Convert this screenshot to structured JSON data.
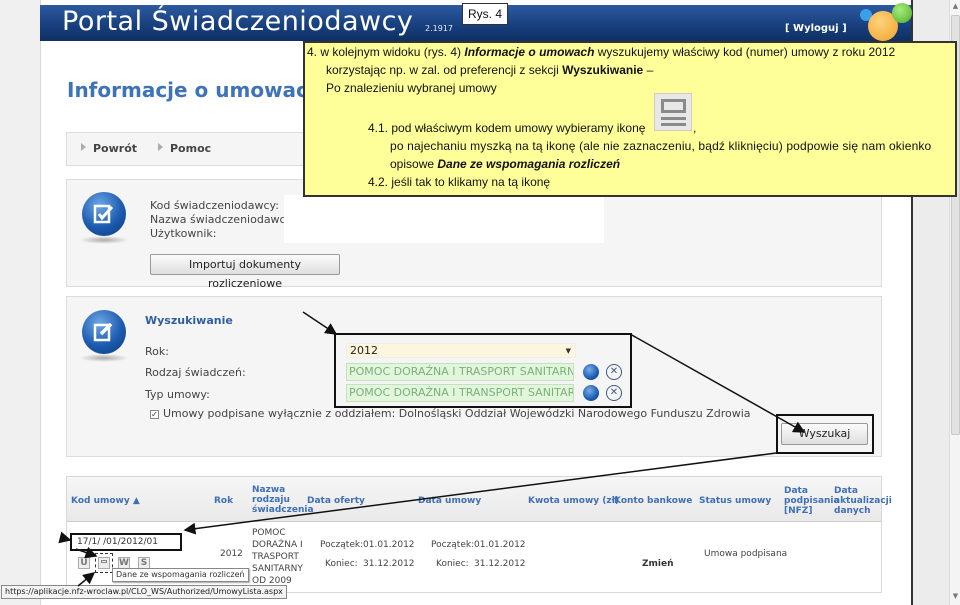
{
  "header": {
    "title": "Portal Świadczeniodawcy",
    "version": "2.1917",
    "logout": "[ Wyloguj ]"
  },
  "figure_label": "Rys. 4",
  "page_title": "Informacje o umowach",
  "nav": {
    "back": "Powrót",
    "help": "Pomoc"
  },
  "provider_info": {
    "labels": [
      "Kod świadczeniodawcy:",
      "Nazwa świadczeniodawcy:",
      "Użytkownik:"
    ],
    "import_button": "Importuj dokumenty rozliczeniowe"
  },
  "search": {
    "title": "Wyszukiwanie",
    "year_label": "Rok:",
    "year_value": "2012",
    "benefit_type_label": "Rodzaj świadczeń:",
    "benefit_type_value": "POMOC DORAŹNA I TRASPORT SANITARNY O",
    "contract_type_label": "Typ umowy:",
    "contract_type_value": "POMOC DORAŹNA I TRANSPORT SANITARNY",
    "checkbox_label": "Umowy podpisane wyłącznie z oddziałem: Dolnośląski Oddział Wojewódzki Narodowego Funduszu Zdrowia",
    "checkbox_checked": true,
    "search_button": "Wyszukaj"
  },
  "table": {
    "columns": [
      "Kod umowy ▲",
      "Rok",
      "Nazwa rodzaju świadczenia",
      "Data oferty",
      "Data umowy",
      "Kwota umowy (zł)",
      "Konto bankowe",
      "Status umowy",
      "Data podpisania [NFZ]",
      "Data aktualizacji danych"
    ],
    "rows": [
      {
        "code": "17/1/          /01/2012/01",
        "year": "2012",
        "benefit_name": "POMOC DORAŹNA I TRASPORT SANITARNY OD 2009",
        "offer_start_label": "Początek:",
        "offer_start": "01.01.2012",
        "offer_end_label": "Koniec:",
        "offer_end": "31.12.2012",
        "contract_start_label": "Początek:",
        "contract_start": "01.01.2012",
        "contract_end_label": "Koniec:",
        "contract_end": "31.12.2012",
        "bank_action": "Zmień",
        "status": "Umowa podpisana",
        "row_icons": [
          "U",
          "doc",
          "W",
          "S"
        ]
      }
    ]
  },
  "tooltip": "Dane ze wspomagania rozliczeń",
  "status_url": "https://aplikacje.nfz-wroclaw.pl/CLO_WS/Authorized/UmowyLista.aspx",
  "callout": {
    "line1_prefix": "4.   w kolejnym widoku (rys. 4) ",
    "line1_em": "Informacje o umowach",
    "line1_suffix": " wyszukujemy właściwy kod (numer) umowy z roku 2012",
    "line2_prefix": "korzystając np. w zal. od preferencji z sekcji ",
    "line2_bold": "Wyszukiwanie",
    "line2_suffix": " –",
    "line3": "Po znalezieniu wybranej umowy",
    "step41_a": "4.1. pod właściwym kodem umowy wybieramy ikonę",
    "step41_comma": ",",
    "step41_b": "po najechaniu myszką na tą ikonę (ale nie zaznaczeniu, bądź kliknięciu) podpowie się nam okienko",
    "step41_c_prefix": "opisowe ",
    "step41_c_em": "Dane ze wspomagania rozliczeń",
    "step42": "4.2. jeśli tak to klikamy na tą ikonę"
  },
  "colors": {
    "header_blue": "#173e7c",
    "link_blue": "#3f6fb5",
    "callout_yellow": "#ffff99",
    "year_field_bg": "#fdf6df",
    "lookup_field_bg": "#e2f6dc"
  }
}
